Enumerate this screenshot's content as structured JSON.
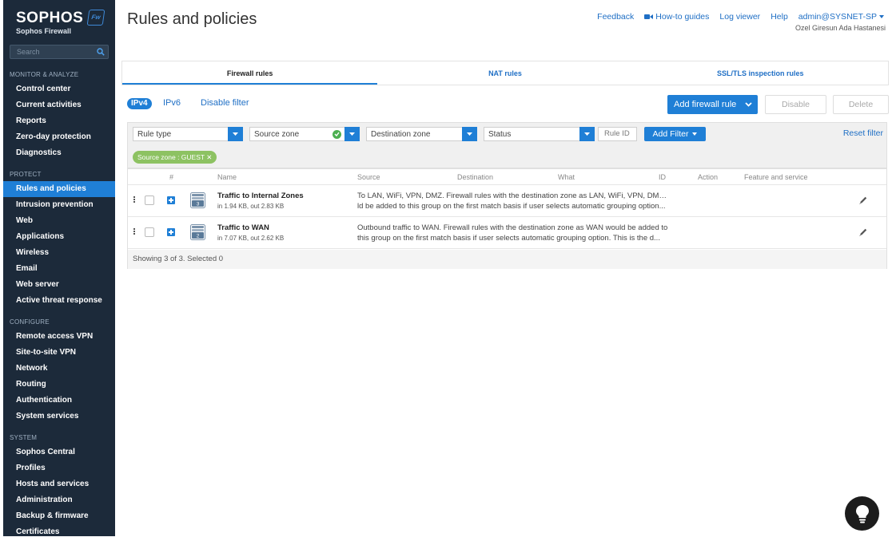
{
  "sidebar": {
    "brand": "SOPHOS",
    "product": "Sophos Firewall",
    "badge": "Fw",
    "search_placeholder": "Search",
    "sections": [
      {
        "label": "MONITOR & ANALYZE",
        "items": [
          "Control center",
          "Current activities",
          "Reports",
          "Zero-day protection",
          "Diagnostics"
        ]
      },
      {
        "label": "PROTECT",
        "items": [
          "Rules and policies",
          "Intrusion prevention",
          "Web",
          "Applications",
          "Wireless",
          "Email",
          "Web server",
          "Active threat response"
        ]
      },
      {
        "label": "CONFIGURE",
        "items": [
          "Remote access VPN",
          "Site-to-site VPN",
          "Network",
          "Routing",
          "Authentication",
          "System services"
        ]
      },
      {
        "label": "SYSTEM",
        "items": [
          "Sophos Central",
          "Profiles",
          "Hosts and services",
          "Administration",
          "Backup & firmware",
          "Certificates"
        ]
      }
    ],
    "active_item": "Rules and policies"
  },
  "header": {
    "title": "Rules and policies",
    "links": {
      "feedback": "Feedback",
      "howto": "How-to guides",
      "log_viewer": "Log viewer",
      "help": "Help",
      "user": "admin@SYSNET-SP"
    },
    "org": "Ozel Giresun Ada Hastanesi"
  },
  "tabs": [
    {
      "label": "Firewall rules",
      "active": true
    },
    {
      "label": "NAT rules",
      "active": false
    },
    {
      "label": "SSL/TLS inspection rules",
      "active": false
    }
  ],
  "toolbar": {
    "ipv4": "IPv4",
    "ipv6": "IPv6",
    "disable_filter": "Disable filter",
    "add_rule": "Add firewall rule",
    "disable": "Disable",
    "delete": "Delete"
  },
  "filters": {
    "rule_type": "Rule type",
    "source_zone": "Source zone",
    "destination_zone": "Destination zone",
    "status": "Status",
    "rule_id_placeholder": "Rule ID",
    "add_filter": "Add Filter",
    "reset": "Reset filter",
    "active_chip": "Source zone : GUEST ✕"
  },
  "table": {
    "columns": {
      "num": "#",
      "name": "Name",
      "source": "Source",
      "destination": "Destination",
      "what": "What",
      "id": "ID",
      "action": "Action",
      "feature": "Feature and service"
    },
    "rows": [
      {
        "count": "3",
        "name": "Traffic to Internal Zones",
        "stats": "in 1.94 KB, out 2.83 KB",
        "desc1": "To LAN, WiFi, VPN, DMZ. Firewall rules with the destination zone as LAN, WiFi, VPN, DMZ wou",
        "desc2": "ld be added to this group on the first match basis if user selects automatic grouping option..."
      },
      {
        "count": "2",
        "name": "Traffic to WAN",
        "stats": "in 7.07 KB, out 2.62 KB",
        "desc1": "Outbound traffic to WAN. Firewall rules with the destination zone as WAN would be added to",
        "desc2": "this group on the first match basis if user selects automatic grouping option. This is the d..."
      }
    ],
    "footer": "Showing 3 of 3. Selected 0"
  },
  "colors": {
    "accent": "#1f7fd6",
    "sidebar": "#1c2a3a",
    "chip": "#8dc262"
  }
}
